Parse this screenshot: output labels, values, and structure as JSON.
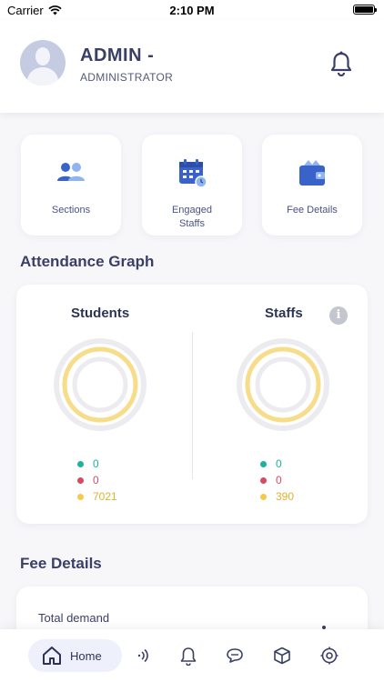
{
  "status_bar": {
    "carrier": "Carrier",
    "time": "2:10 PM"
  },
  "header": {
    "name": "ADMIN -",
    "role": "ADMINISTRATOR"
  },
  "quick_actions": [
    {
      "label": "Sections",
      "icon": "users-icon"
    },
    {
      "label": "Engaged Staffs",
      "icon": "calendar-icon"
    },
    {
      "label": "Fee Details",
      "icon": "wallet-icon"
    }
  ],
  "attendance": {
    "title": "Attendance Graph",
    "students": {
      "label": "Students",
      "legend": [
        "0",
        "0",
        "7021"
      ]
    },
    "staffs": {
      "label": "Staffs",
      "legend": [
        "0",
        "0",
        "390"
      ]
    },
    "info_glyph": "i",
    "colors": {
      "present": "#1db39a",
      "absent": "#d94a5f",
      "other": "#f5c94c",
      "ring": "#f7dc8a",
      "track": "#ececf0"
    }
  },
  "fee": {
    "title": "Fee Details",
    "total_demand_label": "Total demand"
  },
  "bottom_nav": {
    "home_label": "Home",
    "items": [
      "home-icon",
      "broadcast-icon",
      "bell-icon",
      "chat-icon",
      "box-icon",
      "settings-icon"
    ]
  }
}
